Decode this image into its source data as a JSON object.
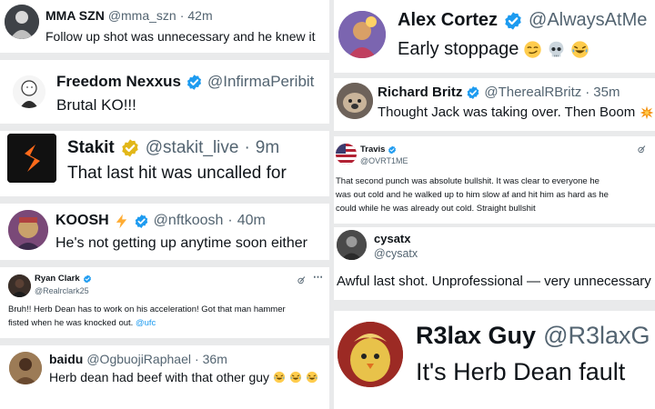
{
  "tweets": {
    "mma": {
      "name": "MMA SZN",
      "handle": "@mma_szn",
      "time": "42m",
      "text": "Follow up shot was unnecessary and he knew it"
    },
    "freedom": {
      "name": "Freedom Nexxus",
      "handle": "@InfirmaPeribit",
      "text": "Brutal KO!!!"
    },
    "stakit": {
      "name": "Stakit",
      "handle": "@stakit_live",
      "time": "9m",
      "text": "That last hit was uncalled for"
    },
    "koosh": {
      "name": "KOOSH",
      "handle": "@nftkoosh",
      "time": "40m",
      "text": "He's not getting up anytime soon either"
    },
    "ryan": {
      "name": "Ryan Clark",
      "handle": "@Realrclark25",
      "text_line1": "Bruh!! Herb Dean has to work on his acceleration! Got that man hammer",
      "text_line2": "fisted when he was knocked out.",
      "mention": "@ufc"
    },
    "baidu": {
      "name": "baidu",
      "handle": "@OgbuojiRaphael",
      "time": "36m",
      "text": "Herb dean had beef with that other guy"
    },
    "alex": {
      "name": "Alex Cortez",
      "handle": "@AlwaysAtMe",
      "text": "Early stoppage"
    },
    "richard": {
      "name": "Richard Britz",
      "handle": "@TherealRBritz",
      "time": "35m",
      "text": "Thought Jack was taking over. Then Boom"
    },
    "travis": {
      "name": "Travis",
      "handle": "@OVRT1ME",
      "lines": [
        "That second punch was absolute bullshit. It was clear to everyone he",
        "was out cold and he walked up to him slow af and hit him as hard as he",
        "could while he was already out cold. Straight bullshit"
      ]
    },
    "cysatx": {
      "name": "cysatx",
      "handle": "@cysatx",
      "text": "Awful last shot.  Unprofessional — very unnecessary"
    },
    "r3lax": {
      "name": "R3lax Guy",
      "handle": "@R3laxG",
      "text": "It's Herb Dean fault"
    }
  },
  "separator": "·",
  "colors": {
    "verified_blue": "#1d9bf0",
    "verified_gold": "#e2b719",
    "handle_gray": "#536471",
    "tile_gray": "#e9eaeb"
  },
  "icons": [
    "verified-badge-icon",
    "grok-icon",
    "lightning-emoji",
    "smirk-emoji",
    "skull-emoji",
    "laughing-emoji",
    "explosion-emoji"
  ]
}
